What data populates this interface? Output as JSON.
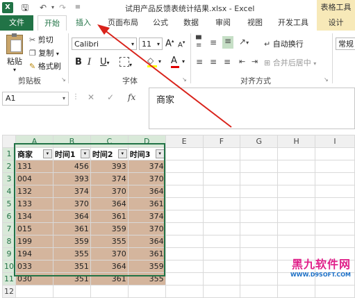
{
  "colors": {
    "excel_green": "#217346",
    "data_fill": "#d4b59d",
    "context_tab": "#f7e9b8",
    "arrow": "#d9231b"
  },
  "titlebar": {
    "title": "试用产品反馈表统计结果.xlsx - Excel",
    "context_header": "表格工具",
    "icons": [
      "excel-logo-icon",
      "save-icon",
      "undo-icon",
      "redo-icon"
    ]
  },
  "tabs": [
    "文件",
    "开始",
    "插入",
    "页面布局",
    "公式",
    "数据",
    "审阅",
    "视图",
    "开发工具",
    "设计"
  ],
  "ribbon": {
    "paste_label": "粘贴",
    "cut_label": "剪切",
    "copy_label": "复制",
    "format_painter_label": "格式刷",
    "clipboard_group": "剪贴板",
    "font_name": "Calibri",
    "font_size": "11",
    "bold": "B",
    "italic": "I",
    "underline": "U",
    "font_color_letter": "A",
    "increase_font": "A",
    "decrease_font": "A",
    "font_group": "字体",
    "wrap_text_label": "自动换行",
    "merge_label": "合并后居中",
    "align_group": "对齐方式",
    "number_format": "常规"
  },
  "formula_bar": {
    "name_box": "A1",
    "fx": "fx",
    "content": "商家"
  },
  "sheet": {
    "columns": [
      "A",
      "B",
      "C",
      "D",
      "E",
      "F",
      "G",
      "H",
      "I"
    ],
    "rows": [
      "1",
      "2",
      "3",
      "4",
      "5",
      "6",
      "7",
      "8",
      "9",
      "10",
      "11",
      "12"
    ],
    "headers": [
      "商家",
      "时间1",
      "时间2",
      "时间3"
    ],
    "data": [
      [
        "131",
        "456",
        "393",
        "374"
      ],
      [
        "004",
        "393",
        "374",
        "370"
      ],
      [
        "132",
        "374",
        "370",
        "364"
      ],
      [
        "133",
        "370",
        "364",
        "361"
      ],
      [
        "134",
        "364",
        "361",
        "374"
      ],
      [
        "015",
        "361",
        "359",
        "370"
      ],
      [
        "199",
        "359",
        "355",
        "364"
      ],
      [
        "194",
        "355",
        "370",
        "361"
      ],
      [
        "033",
        "351",
        "364",
        "359"
      ],
      [
        "030",
        "351",
        "361",
        "355"
      ]
    ]
  },
  "watermark": {
    "line1": "黑九软件网",
    "line2": "WWW.D9SOFT.COM"
  }
}
